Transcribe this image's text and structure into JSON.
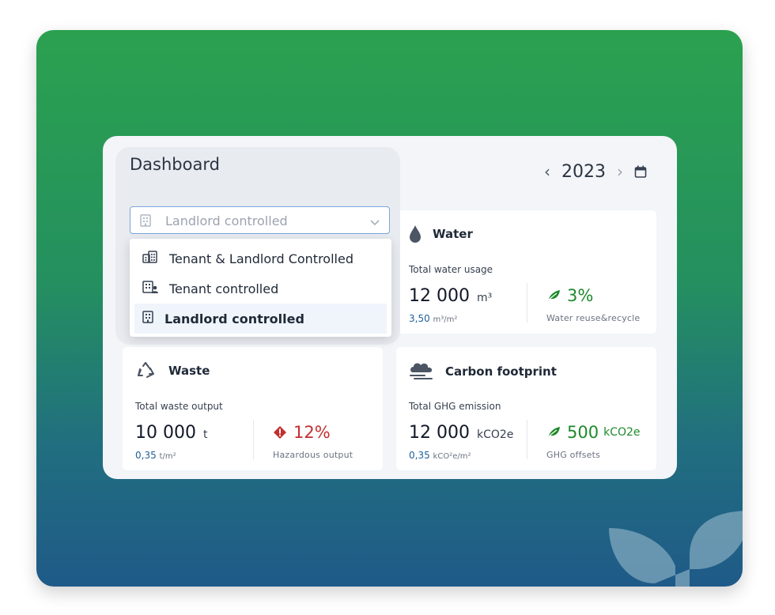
{
  "header": {
    "title": "Dashboard",
    "year": "2023",
    "prev_icon": "chevron-left-icon",
    "next_icon": "chevron-right-icon",
    "calendar_icon": "calendar-icon"
  },
  "control_select": {
    "value": "Landlord controlled",
    "icon": "building-icon",
    "options": [
      {
        "label": "Tenant & Landlord Controlled",
        "icon": "buildings-icon"
      },
      {
        "label": "Tenant controlled",
        "icon": "building-person-icon"
      },
      {
        "label": "Landlord controlled",
        "icon": "building-icon",
        "selected": true
      }
    ]
  },
  "cards": {
    "water": {
      "title": "Water",
      "subtitle": "Total water usage",
      "value": "12 000",
      "unit": "m³",
      "intensity": "3,50",
      "intensity_unit": "m³/m²",
      "kpi_value": "3%",
      "kpi_caption": "Water reuse&recycle",
      "kpi_status": "positive"
    },
    "waste": {
      "title": "Waste",
      "subtitle": "Total waste output",
      "value": "10 000",
      "unit": "t",
      "intensity": "0,35",
      "intensity_unit": "t/m²",
      "kpi_value": "12%",
      "kpi_caption": "Hazardous output",
      "kpi_status": "warning"
    },
    "carbon": {
      "title": "Carbon footprint",
      "subtitle": "Total GHG emission",
      "value": "12 000",
      "unit": "kCO2e",
      "intensity": "0,35",
      "intensity_unit": "kCO²e/m²",
      "kpi_value": "500",
      "kpi_unit": "kCO2e",
      "kpi_caption": "GHG offsets",
      "kpi_status": "positive"
    }
  },
  "colors": {
    "positive": "#1e8a2b",
    "warning": "#c52e2e",
    "accent": "#1f5f9a",
    "gradient_top": "#2ba14f",
    "gradient_bottom": "#1f5a88"
  }
}
